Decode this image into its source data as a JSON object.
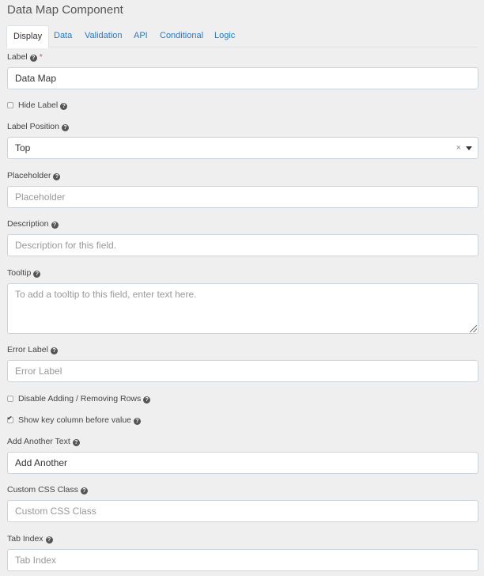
{
  "title": "Data Map Component",
  "tabs": [
    {
      "label": "Display",
      "active": true
    },
    {
      "label": "Data"
    },
    {
      "label": "Validation"
    },
    {
      "label": "API"
    },
    {
      "label": "Conditional"
    },
    {
      "label": "Logic"
    }
  ],
  "help_glyph": "?",
  "required_mark": "*",
  "fields": {
    "label": {
      "label": "Label",
      "value": "Data Map"
    },
    "hide_label": {
      "label": "Hide Label",
      "checked": false
    },
    "label_position": {
      "label": "Label Position",
      "value": "Top",
      "clear_glyph": "×"
    },
    "placeholder": {
      "label": "Placeholder",
      "placeholder": "Placeholder"
    },
    "description": {
      "label": "Description",
      "placeholder": "Description for this field."
    },
    "tooltip": {
      "label": "Tooltip",
      "placeholder": "To add a tooltip to this field, enter text here."
    },
    "error_label": {
      "label": "Error Label",
      "placeholder": "Error Label"
    },
    "disable_adding": {
      "label": "Disable Adding / Removing Rows",
      "checked": false
    },
    "show_key": {
      "label": "Show key column before value",
      "checked": true
    },
    "add_another": {
      "label": "Add Another Text",
      "value": "Add Another"
    },
    "custom_css": {
      "label": "Custom CSS Class",
      "placeholder": "Custom CSS Class"
    },
    "tab_index": {
      "label": "Tab Index",
      "placeholder": "Tab Index"
    }
  }
}
